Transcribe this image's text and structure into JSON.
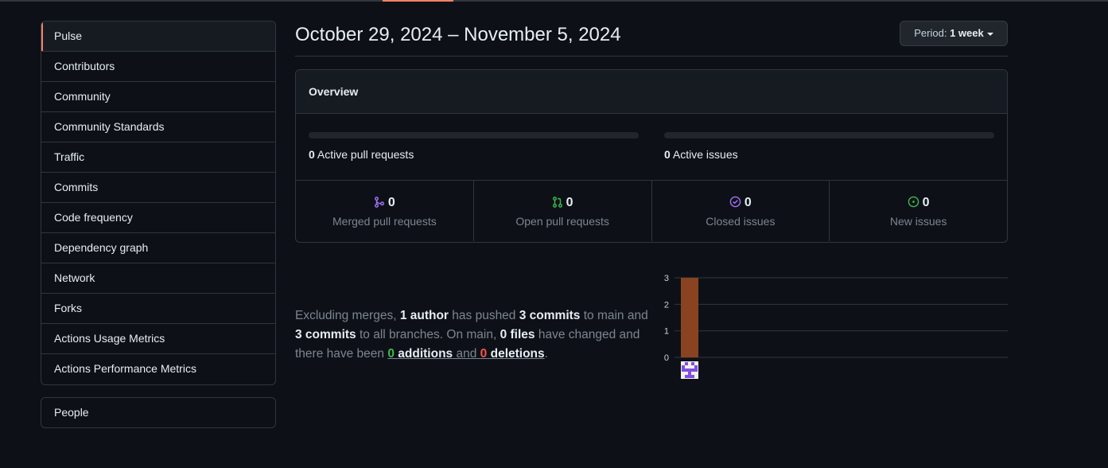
{
  "sidebar": {
    "items": [
      {
        "label": "Pulse",
        "selected": true
      },
      {
        "label": "Contributors"
      },
      {
        "label": "Community"
      },
      {
        "label": "Community Standards"
      },
      {
        "label": "Traffic"
      },
      {
        "label": "Commits"
      },
      {
        "label": "Code frequency"
      },
      {
        "label": "Dependency graph"
      },
      {
        "label": "Network"
      },
      {
        "label": "Forks"
      },
      {
        "label": "Actions Usage Metrics"
      },
      {
        "label": "Actions Performance Metrics"
      }
    ],
    "people_label": "People"
  },
  "header": {
    "date_range": "October 29, 2024 – November 5, 2024",
    "period_label": "Period:",
    "period_value": "1 week"
  },
  "overview": {
    "title": "Overview",
    "active_pull_requests": {
      "count": "0",
      "label": "Active pull requests"
    },
    "active_issues": {
      "count": "0",
      "label": "Active issues"
    },
    "stats": [
      {
        "value": "0",
        "label": "Merged pull requests",
        "icon": "git-merge-icon",
        "color": "#a371f7"
      },
      {
        "value": "0",
        "label": "Open pull requests",
        "icon": "git-pull-request-icon",
        "color": "#3fb950"
      },
      {
        "value": "0",
        "label": "Closed issues",
        "icon": "issue-closed-icon",
        "color": "#a371f7"
      },
      {
        "value": "0",
        "label": "New issues",
        "icon": "issue-opened-icon",
        "color": "#3fb950"
      }
    ]
  },
  "summary": {
    "t1": "Excluding merges, ",
    "authors": "1 author",
    "t2": " has pushed ",
    "commits_main": "3 commits",
    "t3": " to main and ",
    "commits_all": "3 commits",
    "t4": " to all branches. On main, ",
    "files": "0 files",
    "t5": " have changed and there have been ",
    "additions_count": "0",
    "additions_label": "additions",
    "and": "and",
    "deletions_count": "0",
    "deletions_label": "deletions",
    "t6": "."
  },
  "chart_data": {
    "type": "bar",
    "categories": [
      "author-1"
    ],
    "values": [
      3
    ],
    "ylim": [
      0,
      3
    ],
    "yticks": [
      "0",
      "1",
      "2",
      "3"
    ],
    "grid": true,
    "bar_color": "#8a4320"
  }
}
